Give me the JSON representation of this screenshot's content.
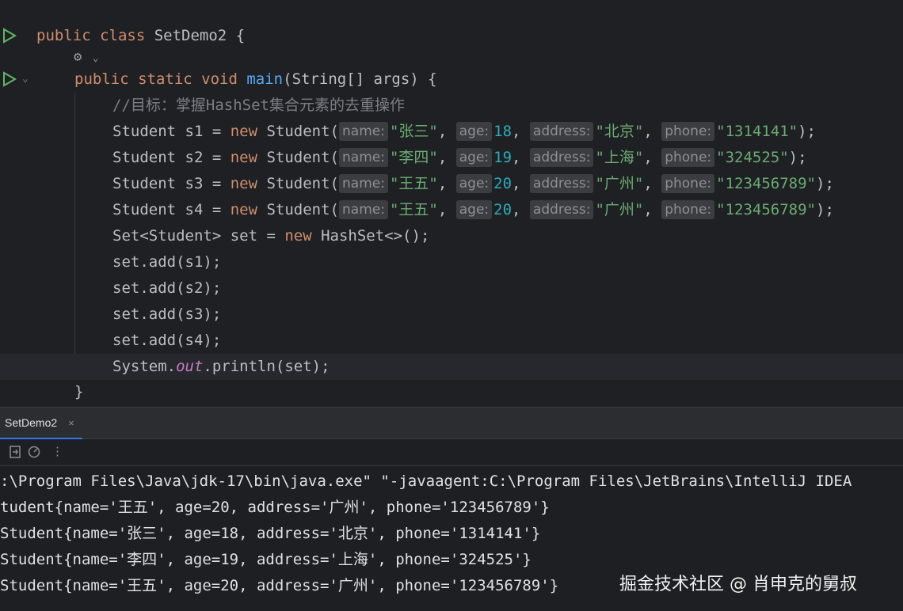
{
  "editor": {
    "class_line": {
      "kw": "public class",
      "name": "SetDemo2",
      "brace": " {"
    },
    "main_line": {
      "kw": "public static void",
      "fn": "main",
      "params": "(String[] args) {"
    },
    "comment": "//目标：掌握HashSet集合元素的去重操作",
    "students": [
      {
        "decl": "Student s1 = ",
        "kw": "new",
        "ctor": " Student(",
        "name": "\"张三\"",
        "age": "18",
        "address": "\"北京\"",
        "phone": "\"1314141\"",
        "end": ");"
      },
      {
        "decl": "Student s2 = ",
        "kw": "new",
        "ctor": " Student(",
        "name": "\"李四\"",
        "age": "19",
        "address": "\"上海\"",
        "phone": "\"324525\"",
        "end": ");"
      },
      {
        "decl": "Student s3 = ",
        "kw": "new",
        "ctor": " Student(",
        "name": "\"王五\"",
        "age": "20",
        "address": "\"广州\"",
        "phone": "\"123456789\"",
        "end": ");"
      },
      {
        "decl": "Student s4 = ",
        "kw": "new",
        "ctor": " Student(",
        "name": "\"王五\"",
        "age": "20",
        "address": "\"广州\"",
        "phone": "\"123456789\"",
        "end": ");"
      }
    ],
    "hints": {
      "name": "name:",
      "age": "age:",
      "address": "address:",
      "phone": "phone:"
    },
    "set_line": {
      "pre": "Set<Student> set = ",
      "kw": "new",
      "post": " HashSet<>();"
    },
    "adds": [
      "set.add(s1);",
      "set.add(s2);",
      "set.add(s3);",
      "set.add(s4);"
    ],
    "print_line": {
      "pre": "System.",
      "field": "out",
      "post": ".println(set);"
    },
    "close_brace": "}"
  },
  "run_panel": {
    "tab_label": "SetDemo2",
    "tab_close": "×"
  },
  "console": {
    "lines": [
      ":\\Program Files\\Java\\jdk-17\\bin\\java.exe\" \"-javaagent:C:\\Program Files\\JetBrains\\IntelliJ IDEA",
      "tudent{name='王五', age=20, address='广州', phone='123456789'}",
      "Student{name='张三', age=18, address='北京', phone='1314141'}",
      "Student{name='李四', age=19, address='上海', phone='324525'}",
      "Student{name='王五', age=20, address='广州', phone='123456789'}"
    ]
  },
  "watermark": "掘金技术社区 @ 肖申克的舅叔",
  "colors": {
    "keyword": "#cf8e6d",
    "function": "#56a8f5",
    "string": "#6aab73",
    "number": "#2aacb8",
    "comment": "#7a7e85",
    "accent": "#3574f0"
  }
}
